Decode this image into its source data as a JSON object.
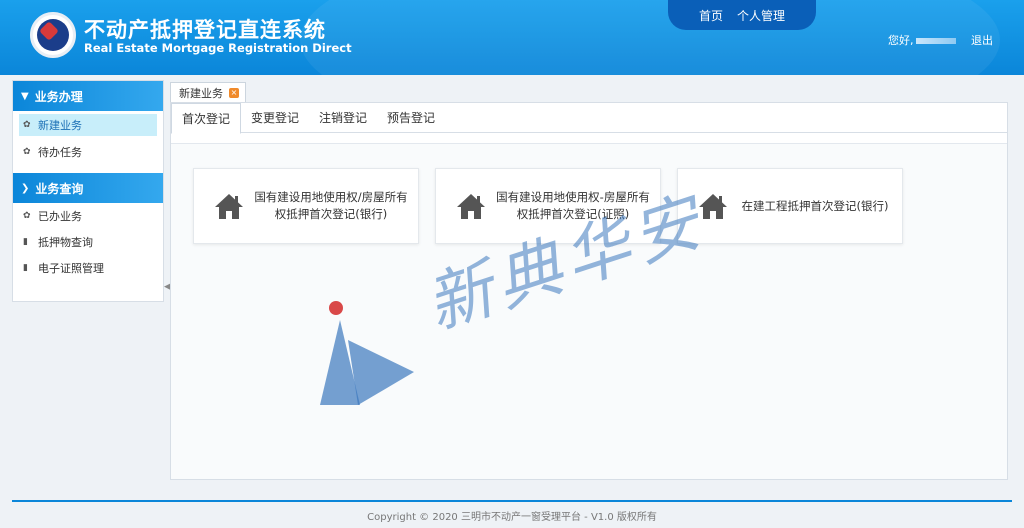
{
  "header": {
    "title_cn": "不动产抵押登记直连系统",
    "title_en": "Real Estate Mortgage Registration Direct",
    "nav": [
      "首页",
      "个人管理"
    ],
    "greeting": "您好,",
    "logout": "退出"
  },
  "sidebar": {
    "groups": [
      {
        "title": "业务办理",
        "items": [
          "新建业务",
          "待办任务"
        ]
      },
      {
        "title": "业务查询",
        "items": [
          "已办业务",
          "抵押物查询",
          "电子证照管理"
        ]
      }
    ]
  },
  "main": {
    "outer_tab": "新建业务",
    "subtabs": [
      "首次登记",
      "变更登记",
      "注销登记",
      "预告登记"
    ],
    "cards": [
      "国有建设用地使用权/房屋所有权抵押首次登记(银行)",
      "国有建设用地使用权-房屋所有权抵押首次登记(证照)",
      "在建工程抵押首次登记(银行)"
    ]
  },
  "watermark": {
    "text": "新典华安"
  },
  "footer": {
    "text": "Copyright © 2020   三明市不动产一窗受理平台 - V1.0   版权所有"
  },
  "colors": {
    "header": "#0b86d9",
    "nav_active": "#0a5fb8",
    "active_item": "#c8eefa"
  }
}
